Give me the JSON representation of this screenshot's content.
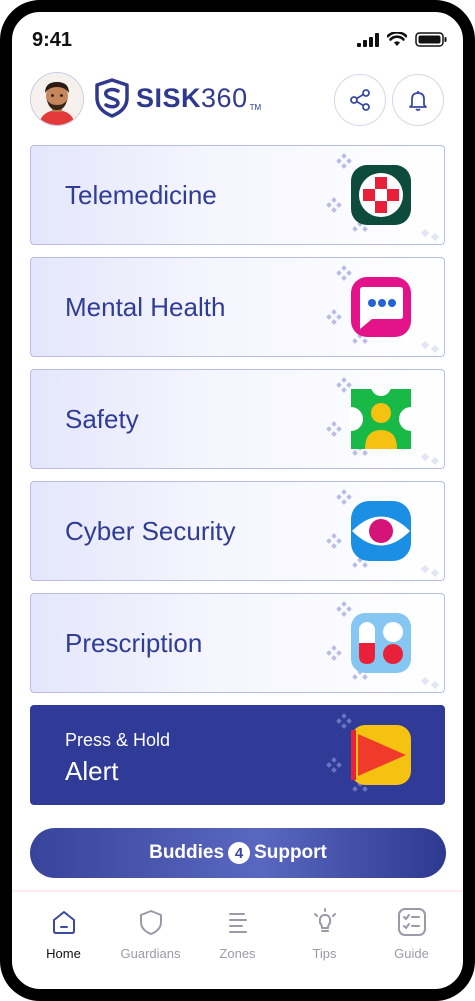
{
  "status_bar": {
    "time": "9:41"
  },
  "header": {
    "logo_bold": "SISK",
    "logo_light": "360",
    "logo_tm": "TM"
  },
  "cards": [
    {
      "label": "Telemedicine",
      "icon": "medical-cross-icon"
    },
    {
      "label": "Mental Health",
      "icon": "chat-bubble-icon"
    },
    {
      "label": "Safety",
      "icon": "safety-figures-icon"
    },
    {
      "label": "Cyber Security",
      "icon": "eye-icon"
    },
    {
      "label": "Prescription",
      "icon": "pills-icon"
    }
  ],
  "alert": {
    "subtitle": "Press & Hold",
    "title": "Alert",
    "icon": "alert-flag-icon"
  },
  "buddies": {
    "left": "Buddies",
    "digit": "4",
    "right": "Support"
  },
  "tabs": [
    {
      "label": "Home",
      "icon": "home-icon",
      "active": true
    },
    {
      "label": "Guardians",
      "icon": "shield-icon",
      "active": false
    },
    {
      "label": "Zones",
      "icon": "zones-list-icon",
      "active": false
    },
    {
      "label": "Tips",
      "icon": "lightbulb-icon",
      "active": false
    },
    {
      "label": "Guide",
      "icon": "guide-checklist-icon",
      "active": false
    }
  ],
  "colors": {
    "brand": "#2f3b96",
    "card_border": "#b7bdeb",
    "accent_red": "#e8203a"
  }
}
